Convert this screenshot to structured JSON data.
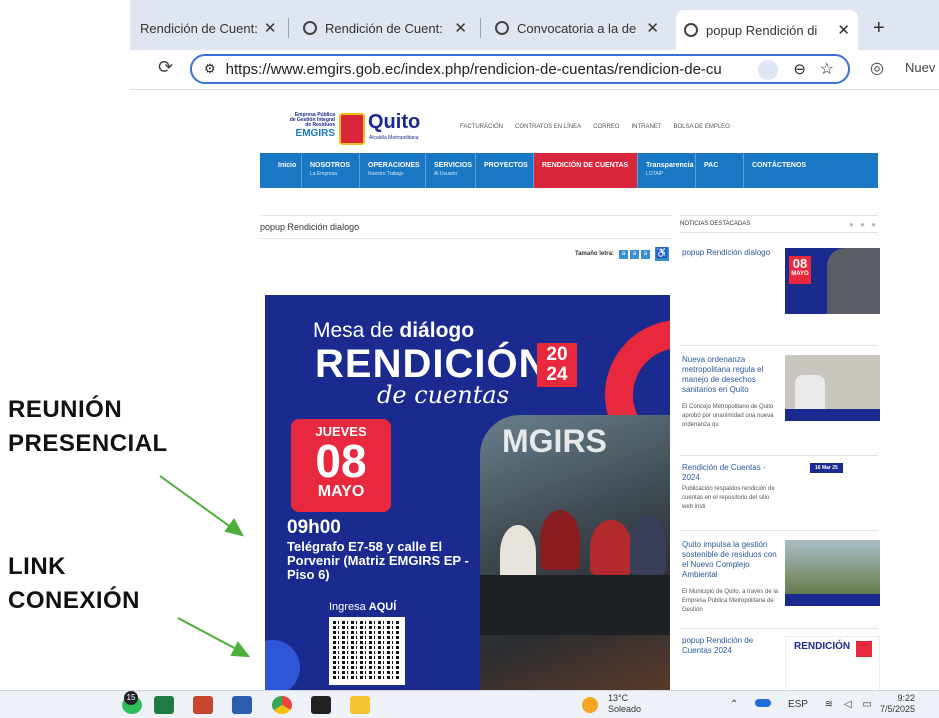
{
  "browser": {
    "tabs": [
      {
        "label": "Rendición de Cuent:",
        "close": "✕"
      },
      {
        "label": "Rendición de Cuent:",
        "close": "✕"
      },
      {
        "label": "Convocatoria a la de",
        "close": "✕"
      },
      {
        "label": "popup Rendición di",
        "close": "✕"
      }
    ],
    "new_tab": "+",
    "url": "https://www.emgirs.gob.ec/index.php/rendicion-de-cuentas/rendicion-de-cu",
    "right_label": "Nuev"
  },
  "site": {
    "logo_line1": "Empresa Pública",
    "logo_line2": "de Gestión Integral",
    "logo_line3": "de Residuos",
    "logo_name": "EMGIRS",
    "quito": "Quito",
    "quito_sub": "Alcaldía Metropolitana",
    "top_links": [
      "FACTURACIÓN",
      "CONTRATOS EN LÍNEA",
      "CORREO",
      "INTRANET",
      "BOLSA DE EMPLEO"
    ],
    "nav": [
      {
        "label": "Inicio",
        "sub": ""
      },
      {
        "label": "NOSOTROS",
        "sub": "La Empresa"
      },
      {
        "label": "OPERACIONES",
        "sub": "Nuestro Trabajo"
      },
      {
        "label": "SERVICIOS",
        "sub": "Al Usuario"
      },
      {
        "label": "PROYECTOS",
        "sub": ""
      },
      {
        "label": "RENDICIÓN DE CUENTAS",
        "sub": ""
      },
      {
        "label": "Transparencia",
        "sub": "LOTAIP"
      },
      {
        "label": "PAC",
        "sub": ""
      },
      {
        "label": "CONTÁCTENOS",
        "sub": ""
      }
    ],
    "page_title": "popup Rendición dialogo",
    "font_size_label": "Tamaño letra:",
    "font_buttons": [
      "a",
      "a",
      "a"
    ],
    "poster": {
      "line1_pre": "Mesa de ",
      "line1_bold": "diálogo",
      "line2": "RENDICIÓN",
      "line3": "de cuentas",
      "year_top": "20",
      "year_bottom": "24",
      "day_name": "JUEVES",
      "day": "08",
      "month": "MAYO",
      "time": "09h00",
      "address": "Telégrafo E7-58 y calle El Porvenir (Matriz EMGIRS EP - Piso 6)",
      "ingresa_pre": "Ingresa ",
      "ingresa_bold": "AQUÍ",
      "photo_text": "MGIRS"
    },
    "news": {
      "header": "NOTICIAS DESTACADAS",
      "dots": "● ● ●",
      "items": [
        {
          "title": "popup Rendición dialogo",
          "desc": ""
        },
        {
          "title": "Nueva ordenanza metropolitana regula el manejo de desechos sanitarios en Quito",
          "desc": "El Concejo Metropolitano de Quito aprobó por unanimidad una nueva ordenanza qu"
        },
        {
          "title": "Rendición de Cuentas - 2024",
          "desc": "Publicación respaldos rendición de cuentas en el repositorio del sitio web insti",
          "date": "16 Mar 25"
        },
        {
          "title": "Quito impulsa la gestión sostenible de residuos con el Nuevo Complejo Ambiental",
          "desc": "El Municipio de Quito, a través de la Empresa Pública Metropolitana de Gestión"
        },
        {
          "title": "popup Rendición de Cuentas 2024",
          "desc": ""
        }
      ],
      "thumb1_day": "08",
      "thumb1_month": "MAYO",
      "thumb5_text": "RENDICIÓN"
    }
  },
  "annotations": {
    "first_line1": "REUNIÓN",
    "first_line2": "PRESENCIAL",
    "second_line1": "LINK",
    "second_line2": "CONEXIÓN",
    "arrow_color": "#4caf3a"
  },
  "taskbar": {
    "badge": "15",
    "weather_temp": "13°C",
    "weather_desc": "Soleado",
    "lang": "ESP",
    "time": "9:22",
    "date": "7/5/2025"
  },
  "colors": {
    "nav_blue": "#1a77c4",
    "nav_active": "#d9263a",
    "poster_blue": "#1b2a8f",
    "poster_red": "#e8283d"
  }
}
